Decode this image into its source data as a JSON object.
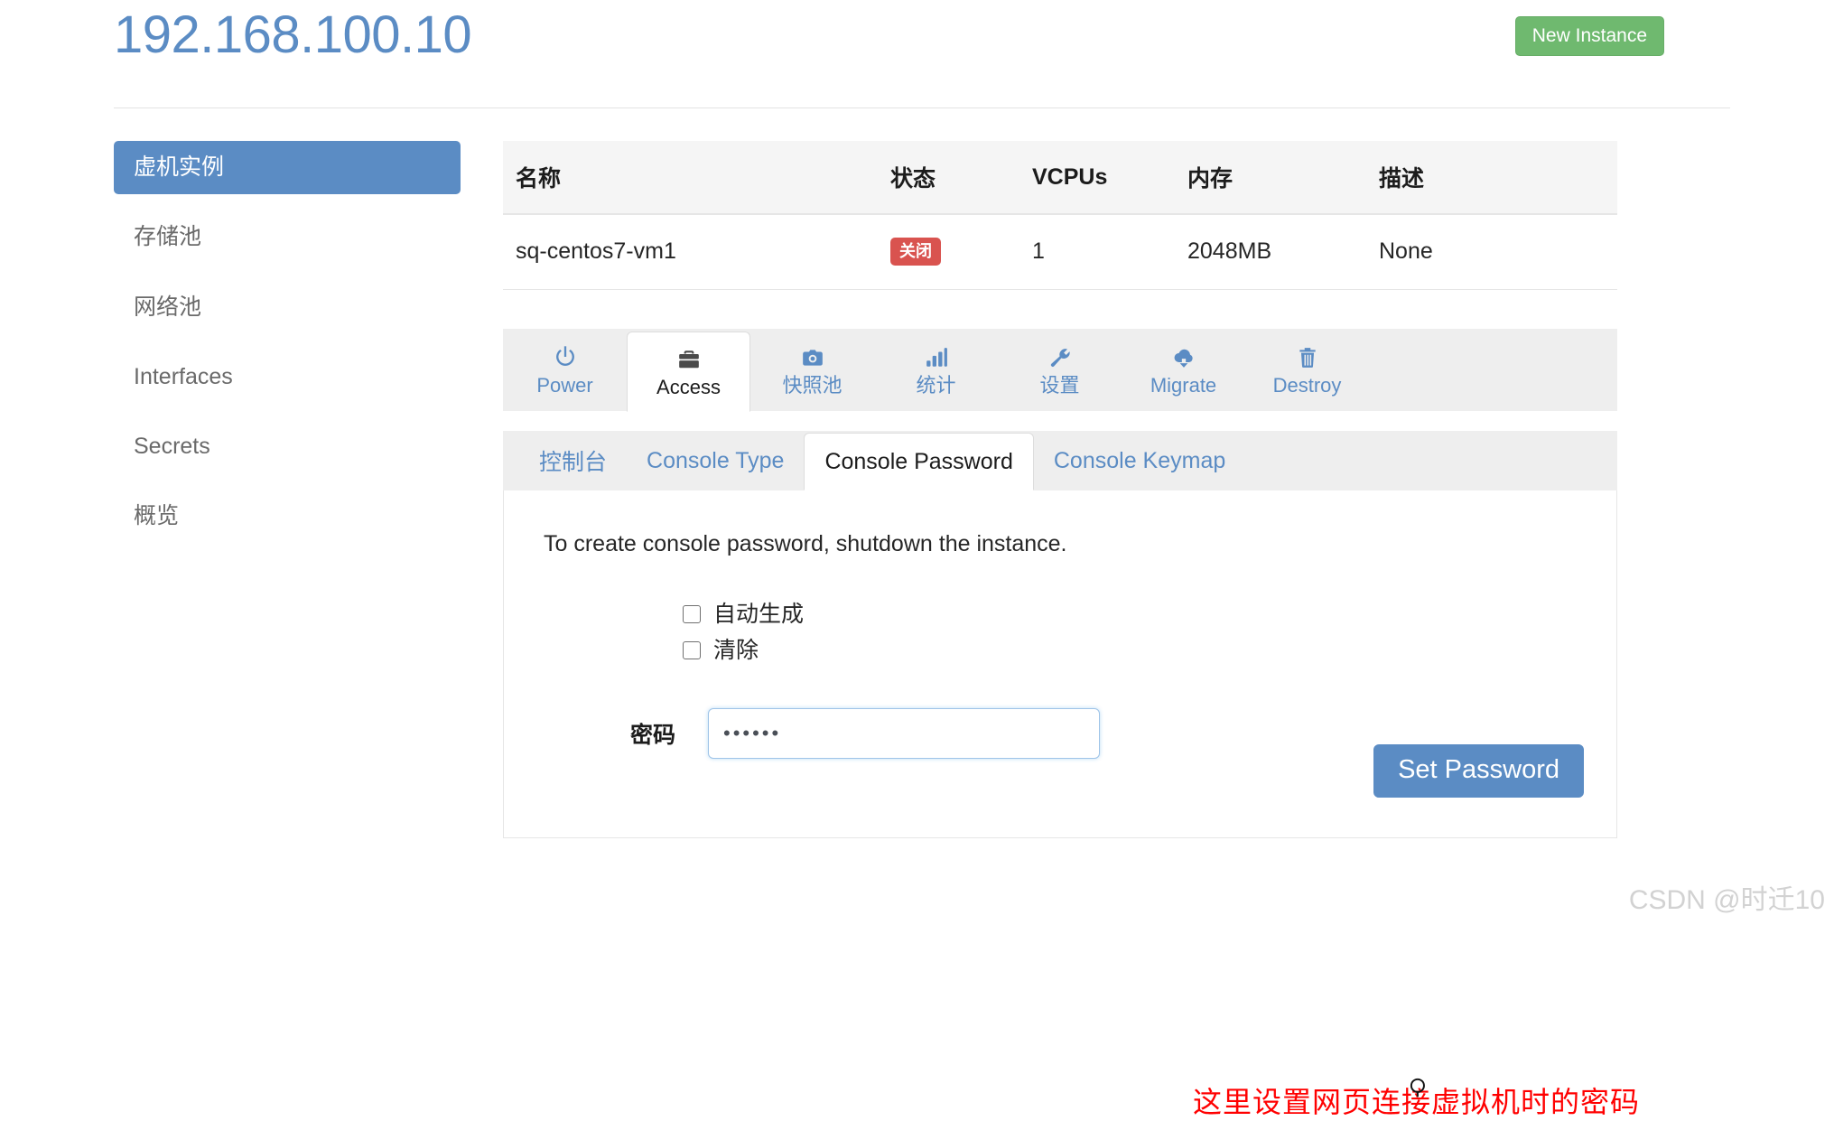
{
  "header": {
    "title": "192.168.100.10",
    "new_instance_label": "New Instance"
  },
  "sidebar": {
    "items": [
      {
        "label": "虚机实例",
        "name": "sidebar-item-instances",
        "active": true
      },
      {
        "label": "存储池",
        "name": "sidebar-item-storage-pool",
        "active": false
      },
      {
        "label": "网络池",
        "name": "sidebar-item-network-pool",
        "active": false
      },
      {
        "label": "Interfaces",
        "name": "sidebar-item-interfaces",
        "active": false
      },
      {
        "label": "Secrets",
        "name": "sidebar-item-secrets",
        "active": false
      },
      {
        "label": "概览",
        "name": "sidebar-item-overview",
        "active": false
      }
    ]
  },
  "table": {
    "columns": [
      "名称",
      "状态",
      "VCPUs",
      "内存",
      "描述"
    ],
    "rows": [
      {
        "name": "sq-centos7-vm1",
        "state": "关闭",
        "state_color": "#d9534f",
        "vcpus": "1",
        "memory": "2048MB",
        "description": "None"
      }
    ]
  },
  "action_tabs": [
    {
      "label": "Power",
      "icon": "power-icon",
      "active": false
    },
    {
      "label": "Access",
      "icon": "briefcase-icon",
      "active": true
    },
    {
      "label": "快照池",
      "icon": "camera-icon",
      "active": false
    },
    {
      "label": "统计",
      "icon": "bar-chart-icon",
      "active": false
    },
    {
      "label": "设置",
      "icon": "wrench-icon",
      "active": false
    },
    {
      "label": "Migrate",
      "icon": "cloud-download-icon",
      "active": false
    },
    {
      "label": "Destroy",
      "icon": "trash-icon",
      "active": false
    }
  ],
  "sub_tabs": [
    {
      "label": "控制台",
      "active": false
    },
    {
      "label": "Console Type",
      "active": false
    },
    {
      "label": "Console Password",
      "active": true
    },
    {
      "label": "Console Keymap",
      "active": false
    }
  ],
  "form": {
    "notice": "To create console password, shutdown the instance.",
    "checkbox_auto_generate": "自动生成",
    "checkbox_clear": "清除",
    "password_label": "密码",
    "password_value": "••••••",
    "submit_label": "Set Password"
  },
  "annotation": {
    "text": "这里设置网页连接虚拟机时的密码",
    "color": "#ff0000"
  },
  "watermark": "CSDN @时迁10",
  "colors": {
    "accent": "#5b8cc4",
    "success": "#6fb96f",
    "danger": "#d9534f",
    "tabbar_bg": "#eeeeee"
  }
}
